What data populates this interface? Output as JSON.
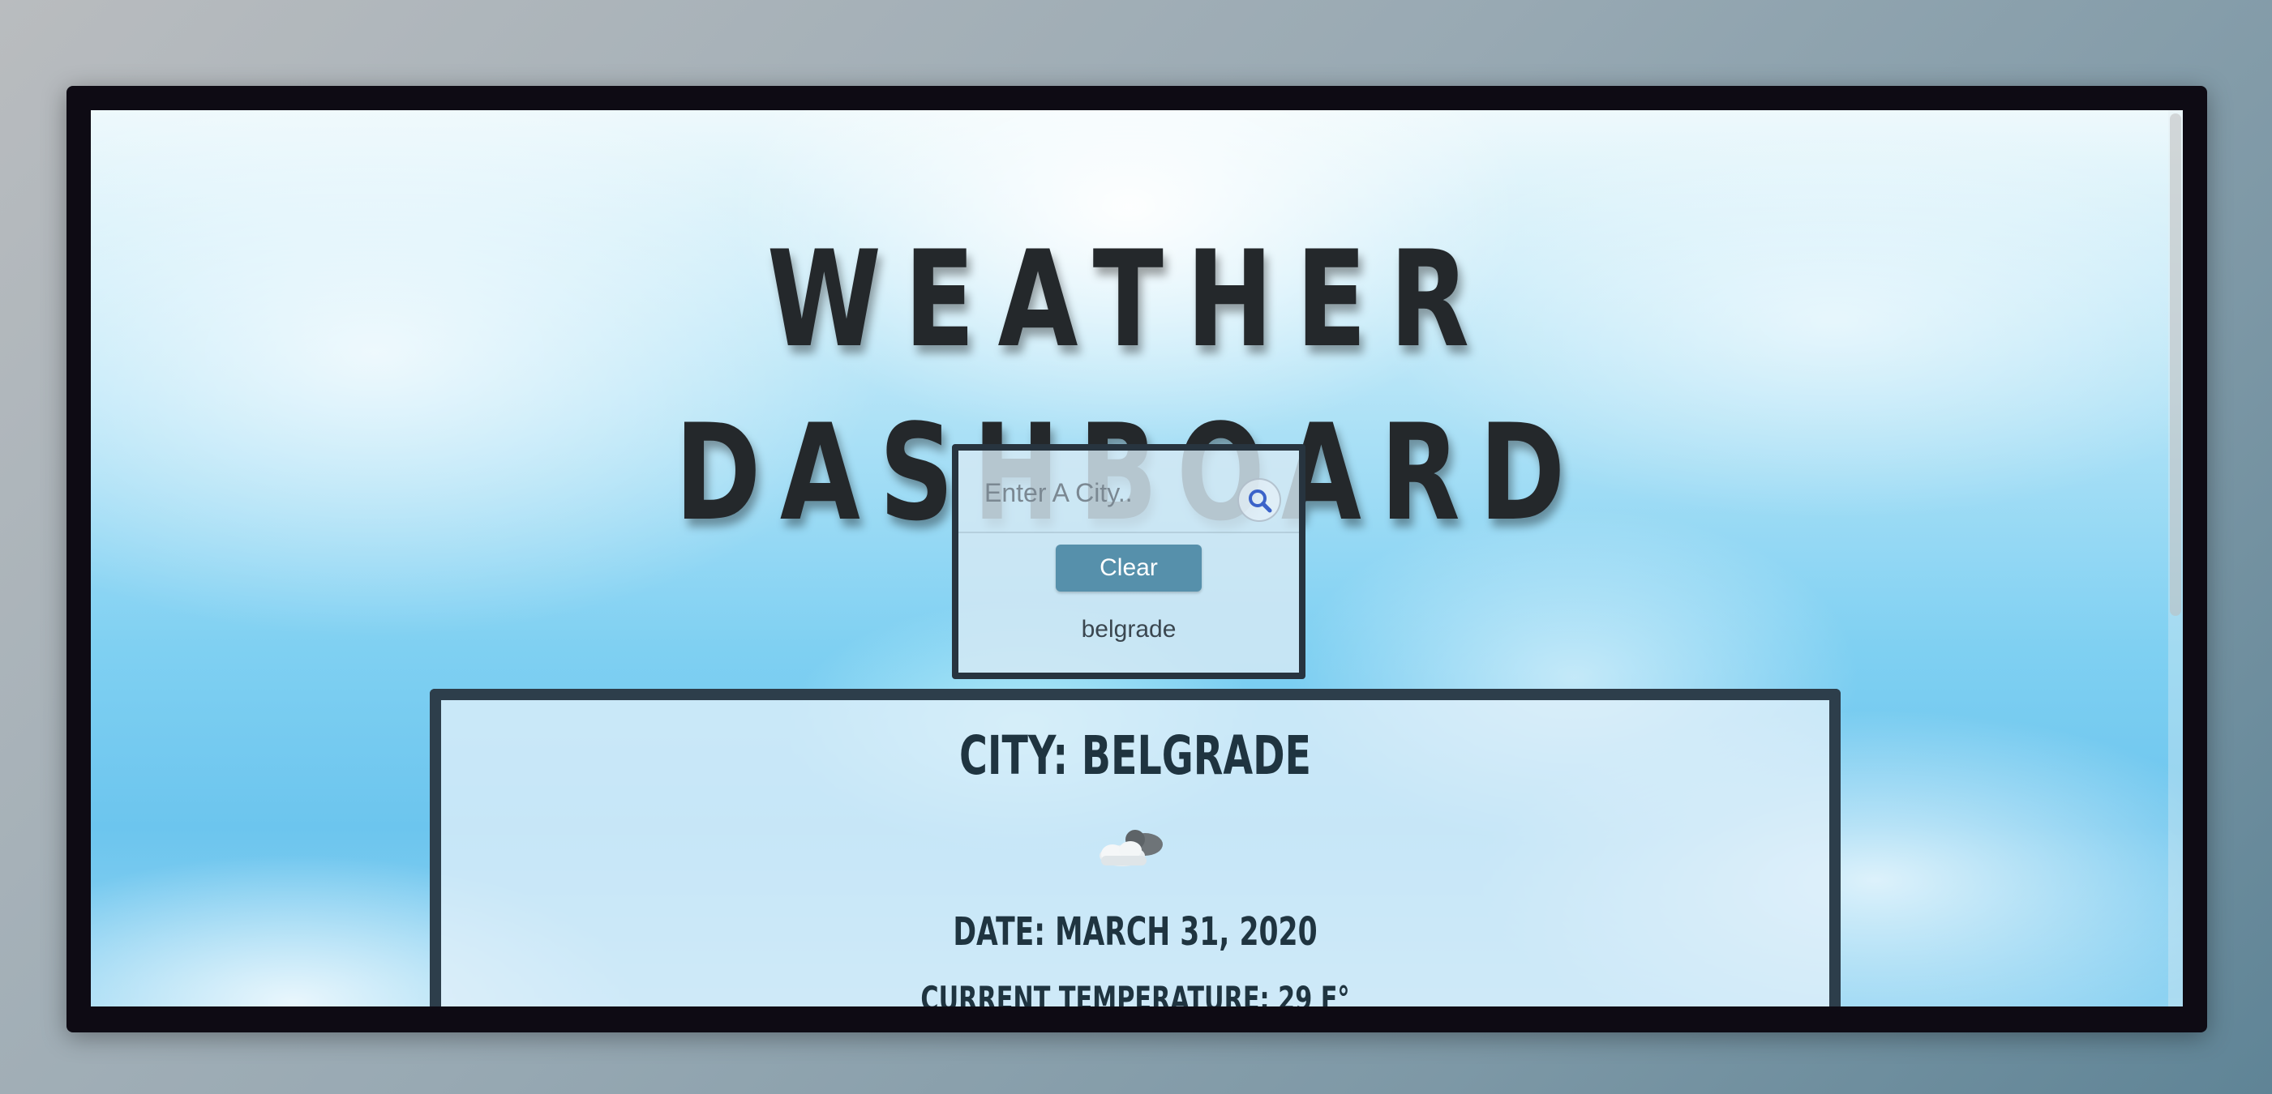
{
  "header": {
    "title_line1": "WEATHER",
    "title_line2": "DASHBOARD"
  },
  "search": {
    "placeholder": "Enter A City..",
    "value": "",
    "search_icon": "search-icon",
    "clear_label": "Clear",
    "history": [
      "belgrade"
    ]
  },
  "weather": {
    "city": "CITY: BELGRADE",
    "icon": "cloud-icon",
    "date": "DATE: MARCH 31, 2020",
    "temperature": "CURRENT TEMPERATURE: 29 F°"
  },
  "colors": {
    "title": "#24282b",
    "panel_border": "#27343f",
    "clear_button": "#5690ab",
    "card_border": "#2d3e4b",
    "card_text": "#1f3440"
  }
}
